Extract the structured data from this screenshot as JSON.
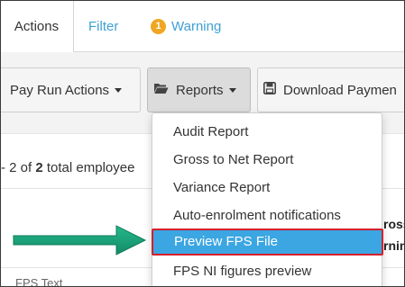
{
  "tabs": {
    "actions": "Actions",
    "filter": "Filter",
    "warning_count": "1",
    "warning": "Warning"
  },
  "toolbar": {
    "pay_run_actions": "Pay Run Actions",
    "reports": "Reports",
    "download_payments": "Download Paymen"
  },
  "list": {
    "count_prefix": "- 2 of ",
    "count_bold": "2",
    "count_suffix": " total employee"
  },
  "cut_off": {
    "right_line1": "ross",
    "right_line2": "rnin",
    "bottom_row": "FPS Text"
  },
  "reports_menu": {
    "items": [
      "Audit Report",
      "Gross to Net Report",
      "Variance Report",
      "Auto-enrolment notifications",
      "Preview FPS File",
      "FPS NI figures preview"
    ],
    "highlighted_index": 4
  },
  "colors": {
    "link": "#3fa0d6",
    "warning_badge": "#f0a623",
    "menu_highlight": "#3ba6e2",
    "highlight_border": "#d61f2b",
    "annotation_arrow": "#1aa37a"
  },
  "icons": {
    "reports": "folder-open-icon",
    "download": "save-icon",
    "dropdown": "caret-down-icon"
  }
}
